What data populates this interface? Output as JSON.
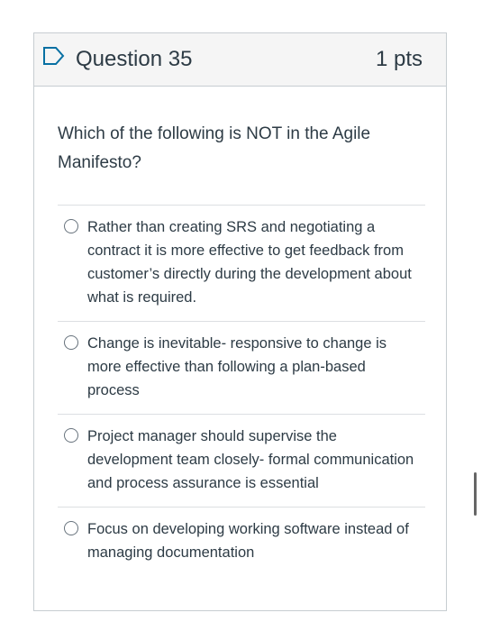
{
  "question": {
    "title": "Question 35",
    "points": "1 pts",
    "text": "Which of the following is NOT in the Agile Manifesto?",
    "flag_icon": "bookmark-flag-icon",
    "accent_color": "#0770a3"
  },
  "answers": [
    {
      "label": "Rather than creating SRS and negotiating a contract it is more effective to get feedback from customer’s directly during the development about what is required."
    },
    {
      "label": "Change is inevitable- responsive to change is more effective than following a plan-based process"
    },
    {
      "label": "Project manager should supervise the development team closely- formal communication and process assurance is essential"
    },
    {
      "label": "Focus on developing working software instead of managing documentation"
    }
  ]
}
